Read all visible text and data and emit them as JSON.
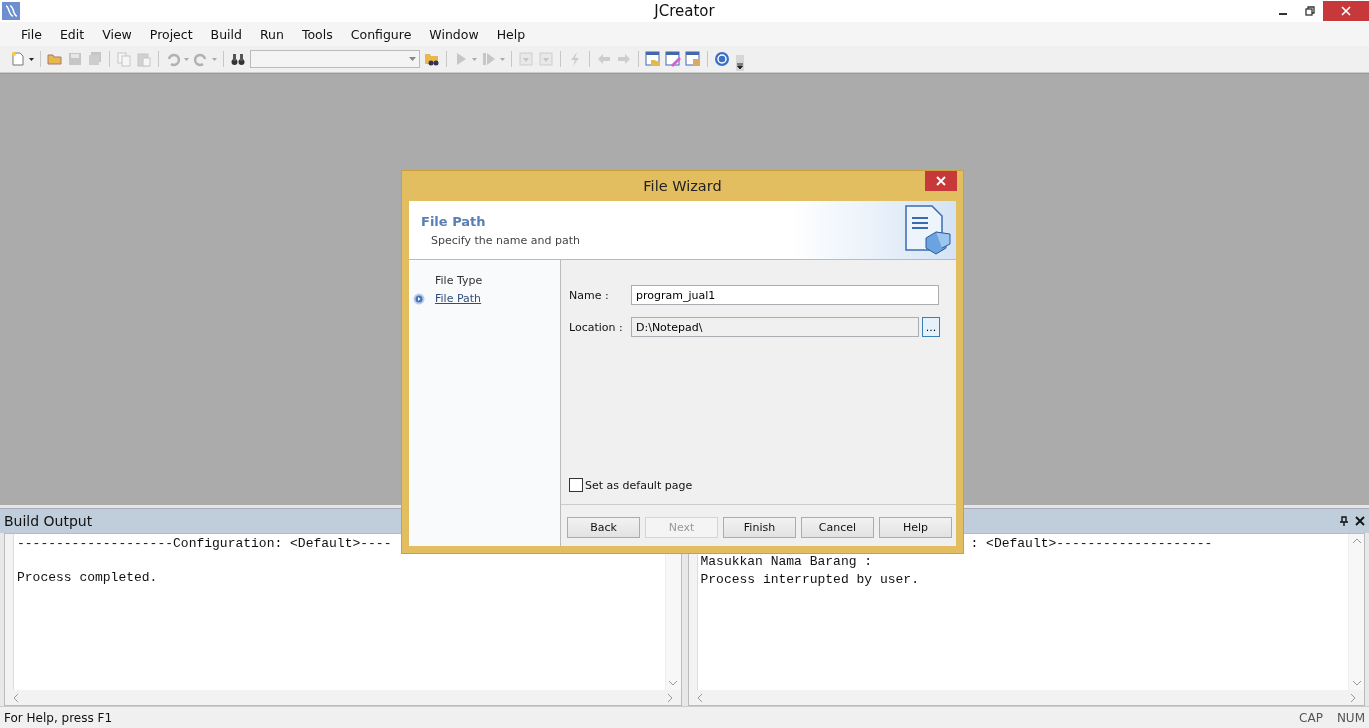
{
  "window": {
    "title": "JCreator"
  },
  "menu": [
    "File",
    "Edit",
    "View",
    "Project",
    "Build",
    "Run",
    "Tools",
    "Configure",
    "Window",
    "Help"
  ],
  "toolbar": [
    {
      "kind": "icon",
      "disabled": false
    },
    {
      "kind": "icon",
      "disabled": false
    },
    {
      "kind": "icon",
      "disabled": true
    },
    {
      "kind": "icon",
      "disabled": true
    },
    {
      "kind": "icon",
      "disabled": true
    },
    {
      "kind": "icon",
      "disabled": true
    },
    {
      "kind": "icon",
      "disabled": true
    },
    {
      "kind": "icon",
      "disabled": true
    },
    {
      "kind": "icon",
      "disabled": false
    },
    {
      "kind": "combo"
    },
    {
      "kind": "icon",
      "disabled": false
    },
    {
      "kind": "icon",
      "disabled": true
    },
    {
      "kind": "icon",
      "disabled": true
    },
    {
      "kind": "icon",
      "disabled": true
    },
    {
      "kind": "icon",
      "disabled": true
    },
    {
      "kind": "icon",
      "disabled": true
    },
    {
      "kind": "icon",
      "disabled": true
    },
    {
      "kind": "icon",
      "disabled": true
    },
    {
      "kind": "icon",
      "disabled": false
    },
    {
      "kind": "icon",
      "disabled": false
    },
    {
      "kind": "icon",
      "disabled": false
    },
    {
      "kind": "icon",
      "disabled": false
    }
  ],
  "build_output": {
    "title": "Build Output",
    "panes": [
      {
        "lines": [
          {
            "text": "--------------------Configuration: <Default>----"
          },
          {
            "text": "Process completed.",
            "blank_line_before": true
          }
        ]
      },
      {
        "lines": [
          {
            "text": ": <Default>--------------------",
            "indented": true
          },
          {
            "text": "Masukkan Nama Barang :"
          },
          {
            "text": "Process interrupted by user."
          }
        ]
      }
    ]
  },
  "dialog": {
    "title": "File Wizard",
    "heading": "File Path",
    "subheading": "Specify the name and path",
    "steps": [
      {
        "label": "File Type",
        "selected": false
      },
      {
        "label": "File Path",
        "selected": true
      }
    ],
    "name_label": "Name :",
    "name_value": "program_jual1",
    "location_label": "Location :",
    "location_value": "D:\\Notepad\\",
    "browse": "...",
    "default_page": {
      "label": "Set as default page",
      "checked": false
    },
    "buttons": [
      {
        "label": "Back",
        "disabled": false
      },
      {
        "label": "Next",
        "disabled": true
      },
      {
        "label": "Finish",
        "disabled": false
      },
      {
        "label": "Cancel",
        "disabled": false
      },
      {
        "label": "Help",
        "disabled": false
      }
    ]
  },
  "status_bar": {
    "text": "For Help, press F1",
    "indicators": [
      "CAP",
      "NUM"
    ]
  }
}
